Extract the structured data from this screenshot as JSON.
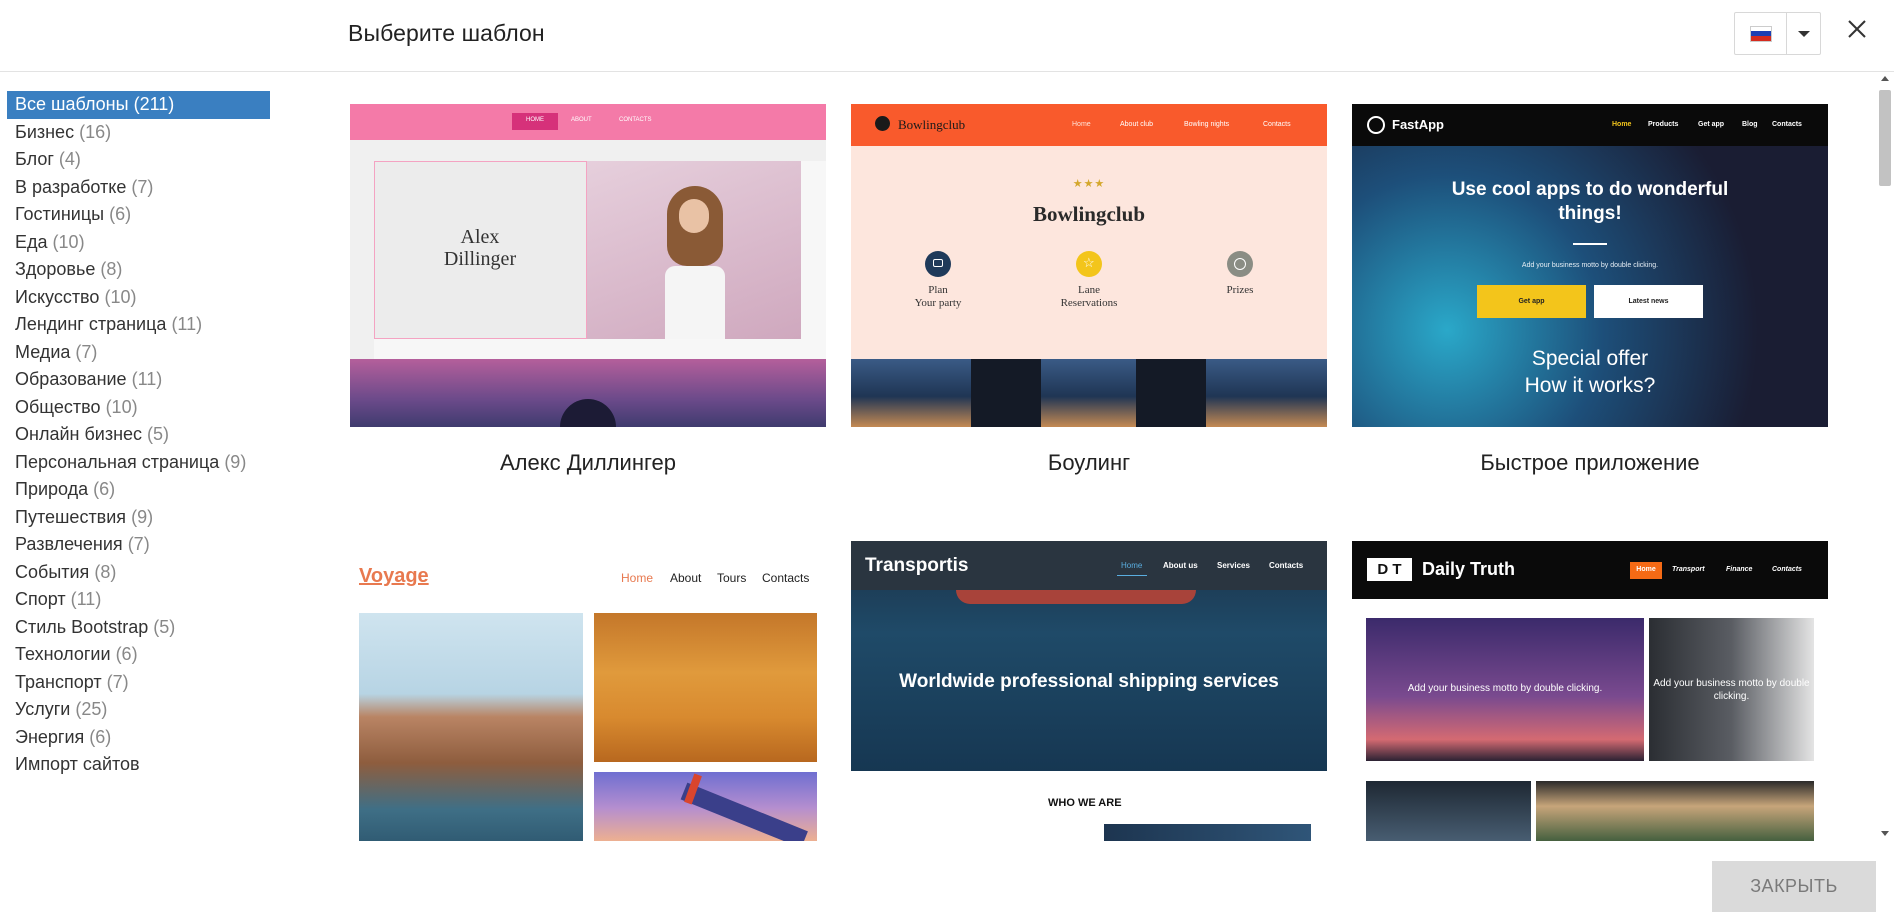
{
  "dialog": {
    "title": "Выберите шаблон",
    "close_button_label": "ЗАКРЫТЬ"
  },
  "language": {
    "selected": "Русский",
    "flag_colors": [
      "#ffffff",
      "#1c3fb3",
      "#d52b1e"
    ]
  },
  "colors": {
    "accent": "#3a7fc1",
    "close_button_bg": "#dadada"
  },
  "categories": [
    {
      "name": "Все шаблоны",
      "count": "(211)",
      "active": true
    },
    {
      "name": "Бизнес",
      "count": "(16)"
    },
    {
      "name": "Блог",
      "count": "(4)"
    },
    {
      "name": "В разработке",
      "count": "(7)"
    },
    {
      "name": "Гостиницы",
      "count": "(6)"
    },
    {
      "name": "Еда",
      "count": "(10)"
    },
    {
      "name": "Здоровье",
      "count": "(8)"
    },
    {
      "name": "Искусство",
      "count": "(10)"
    },
    {
      "name": "Лендинг страница",
      "count": "(11)"
    },
    {
      "name": "Медиа",
      "count": "(7)"
    },
    {
      "name": "Образование",
      "count": "(11)"
    },
    {
      "name": "Общество",
      "count": "(10)"
    },
    {
      "name": "Онлайн бизнес",
      "count": "(5)"
    },
    {
      "name": "Персональная страница",
      "count": "(9)"
    },
    {
      "name": "Природа",
      "count": "(6)"
    },
    {
      "name": "Путешествия",
      "count": "(9)"
    },
    {
      "name": "Развлечения",
      "count": "(7)"
    },
    {
      "name": "События",
      "count": "(8)"
    },
    {
      "name": "Спорт",
      "count": "(11)"
    },
    {
      "name": "Стиль Bootstrap",
      "count": "(5)"
    },
    {
      "name": "Технологии",
      "count": "(6)"
    },
    {
      "name": "Транспорт",
      "count": "(7)"
    },
    {
      "name": "Услуги",
      "count": "(25)"
    },
    {
      "name": "Энергия",
      "count": "(6)"
    },
    {
      "name": "Импорт сайтов",
      "count": ""
    }
  ],
  "templates": [
    {
      "name": "Алекс Диллингер",
      "preview": {
        "nav": [
          "HOME",
          "ABOUT",
          "CONTACTS"
        ],
        "heading_line1": "Alex",
        "heading_line2": "Dillinger"
      }
    },
    {
      "name": "Боулинг",
      "preview": {
        "logo": "Bowlingclub",
        "nav": [
          "Home",
          "About club",
          "Bowling nights",
          "Contacts"
        ],
        "stars": "★★★",
        "heading": "Bowlingclub",
        "features": [
          {
            "line1": "Plan",
            "line2": "Your party",
            "icon": "chat-icon"
          },
          {
            "line1": "Lane",
            "line2": "Reservations",
            "icon": "star-icon"
          },
          {
            "line1": "Prizes",
            "line2": "",
            "icon": "clock-icon"
          }
        ]
      }
    },
    {
      "name": "Быстрое приложение",
      "preview": {
        "logo": "FastApp",
        "nav": [
          "Home",
          "Products",
          "Get app",
          "Blog",
          "Contacts"
        ],
        "headline_line1": "Use cool apps to do wonderful",
        "headline_line2": "things!",
        "motto": "Add your business motto by double clicking.",
        "button_primary": "Get app",
        "button_secondary": "Latest news",
        "offer_line1": "Special offer",
        "offer_line2": "How it works?"
      }
    },
    {
      "name": "",
      "preview": {
        "logo": "Voyage",
        "nav": [
          "Home",
          "About",
          "Tours",
          "Contacts"
        ]
      }
    },
    {
      "name": "",
      "preview": {
        "logo": "Transportis",
        "nav": [
          "Home",
          "About us",
          "Services",
          "Contacts"
        ],
        "headline": "Worldwide professional shipping services",
        "section": "WHO WE ARE"
      }
    },
    {
      "name": "",
      "preview": {
        "logo_mark": "D T",
        "logo": "Daily Truth",
        "nav": [
          "Home",
          "Transport",
          "Finance",
          "Contacts"
        ],
        "motto1": "Add your business motto by double clicking.",
        "motto2": "Add your business motto by double clicking."
      }
    }
  ]
}
